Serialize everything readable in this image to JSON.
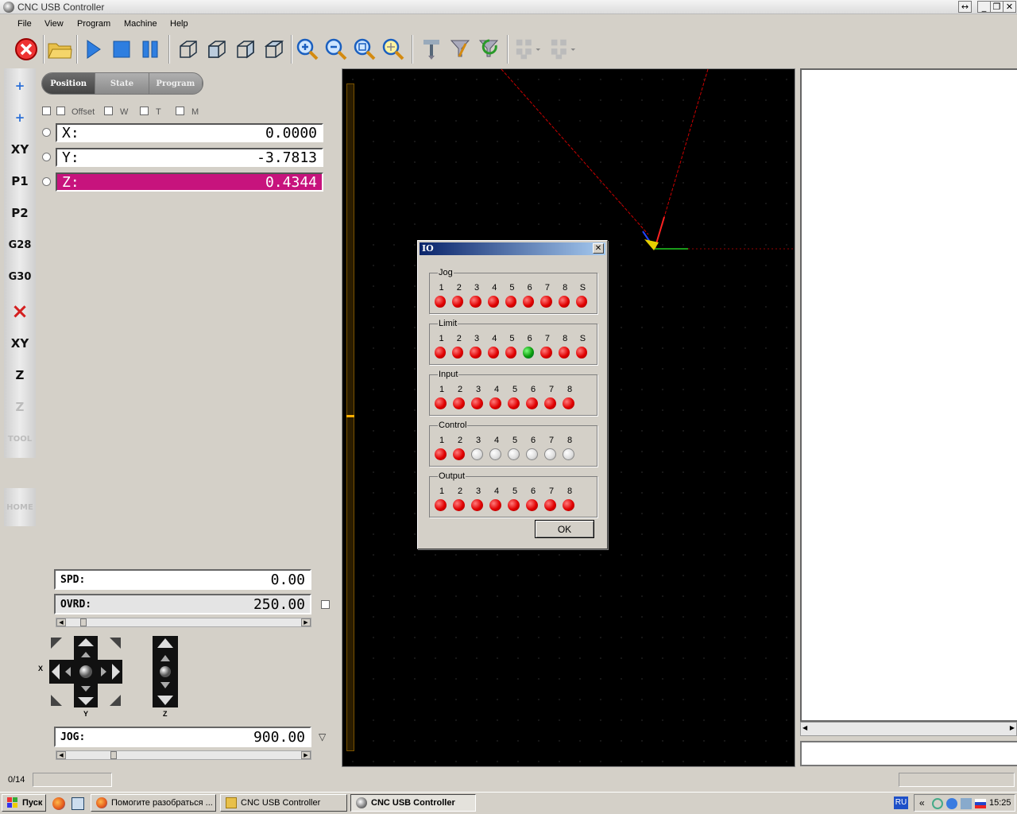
{
  "window": {
    "title": "CNC USB Controller",
    "buttons": [
      "↔",
      "_",
      "❐",
      "✕"
    ]
  },
  "menu": [
    "File",
    "View",
    "Program",
    "Machine",
    "Help"
  ],
  "toolbar": {
    "icons": [
      "stop-icon",
      "open-folder-icon",
      "play-icon",
      "stop-square-icon",
      "pause-icon",
      "cube-iso-icon",
      "cube-front-icon",
      "cube-side-icon",
      "cube-top-icon",
      "zoom-in-icon",
      "zoom-out-icon",
      "zoom-fit-icon",
      "zoom-extent-icon",
      "tool-change-icon",
      "probe-icon",
      "probe-return-icon",
      "jog-grid-icon",
      "jog-grid-dim-icon"
    ]
  },
  "leftbar": {
    "buttons": [
      "+",
      "+",
      "XY",
      "P1",
      "P2",
      "G28",
      "G30",
      "×",
      "XY",
      "Z",
      "Z",
      "TOOL",
      "HOME"
    ]
  },
  "tabs": [
    "Position",
    "State",
    "Program"
  ],
  "active_tab": "Position",
  "checkboxes": [
    "",
    "Offset",
    "W",
    "T",
    "M"
  ],
  "axes": [
    {
      "label": "X:",
      "value": "0.0000"
    },
    {
      "label": "Y:",
      "value": "-3.7813"
    },
    {
      "label": "Z:",
      "value": "0.4344"
    }
  ],
  "spindle": {
    "label": "SPD:",
    "value": "0.00"
  },
  "override": {
    "label": "OVRD:",
    "value": "250.00"
  },
  "jog": {
    "label": "JOG:",
    "value": "900.00"
  },
  "jog_labels": {
    "x": "X",
    "y": "Y",
    "z": "Z"
  },
  "status": {
    "progress": "0/14"
  },
  "dialog": {
    "title": "IO",
    "groups": [
      {
        "name": "Jog",
        "labels": [
          "1",
          "2",
          "3",
          "4",
          "5",
          "6",
          "7",
          "8",
          "S"
        ],
        "states": [
          "red",
          "red",
          "red",
          "red",
          "red",
          "red",
          "red",
          "red",
          "red"
        ]
      },
      {
        "name": "Limit",
        "labels": [
          "1",
          "2",
          "3",
          "4",
          "5",
          "6",
          "7",
          "8",
          "S"
        ],
        "states": [
          "red",
          "red",
          "red",
          "red",
          "red",
          "green",
          "red",
          "red",
          "red"
        ]
      },
      {
        "name": "Input",
        "labels": [
          "1",
          "2",
          "3",
          "4",
          "5",
          "6",
          "7",
          "8"
        ],
        "states": [
          "red",
          "red",
          "red",
          "red",
          "red",
          "red",
          "red",
          "red"
        ]
      },
      {
        "name": "Control",
        "labels": [
          "1",
          "2",
          "3",
          "4",
          "5",
          "6",
          "7",
          "8"
        ],
        "states": [
          "red",
          "red",
          "off",
          "off",
          "off",
          "off",
          "off",
          "off"
        ]
      },
      {
        "name": "Output",
        "labels": [
          "1",
          "2",
          "3",
          "4",
          "5",
          "6",
          "7",
          "8"
        ],
        "states": [
          "red",
          "red",
          "red",
          "red",
          "red",
          "red",
          "red",
          "red"
        ]
      }
    ],
    "ok": "OK"
  },
  "taskbar": {
    "start": "Пуск",
    "tasks": [
      "Помогите разобраться ...",
      "CNC USB Controller",
      "CNC USB Controller"
    ],
    "lang": "RU",
    "clock": "15:25",
    "tray_chevron": "«"
  },
  "colors": {
    "z_highlight": "#c7137d",
    "led_red": "#e00000",
    "led_green": "#0a9a0a",
    "dialog_title": "#0a246a"
  }
}
